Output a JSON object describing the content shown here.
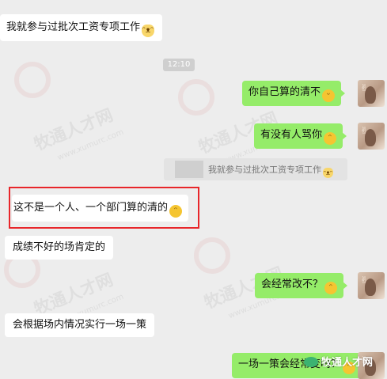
{
  "time": "12:10",
  "messages": [
    {
      "side": "left",
      "text": "我就参与过批次工资专项工作"
    },
    {
      "side": "right",
      "text": "你自己算的清不"
    },
    {
      "side": "right",
      "text": "有没有人骂你"
    },
    {
      "side": "left",
      "text": "这不是一个人、一个部门算的清的"
    },
    {
      "side": "left",
      "text": "成绩不好的场肯定的"
    },
    {
      "side": "right",
      "text": "会经常改不？"
    },
    {
      "side": "left",
      "text": "会根据场内情况实行一场一策"
    },
    {
      "side": "right",
      "text": "一场一策会经常变吗？"
    }
  ],
  "quote": {
    "text": "我就参与过批次工资专项工作"
  },
  "watermark": {
    "text": "牧通人才网",
    "url": "www.xumurc.com"
  },
  "brand": {
    "name": "牧通人才网"
  },
  "colors": {
    "background": "#ededed",
    "green_bubble": "#95ec69",
    "highlight_border": "#e8262a"
  },
  "icons": [
    "laughing-emoji",
    "cat-emoji",
    "smirk-emoji",
    "avatar",
    "wechat-icon"
  ]
}
